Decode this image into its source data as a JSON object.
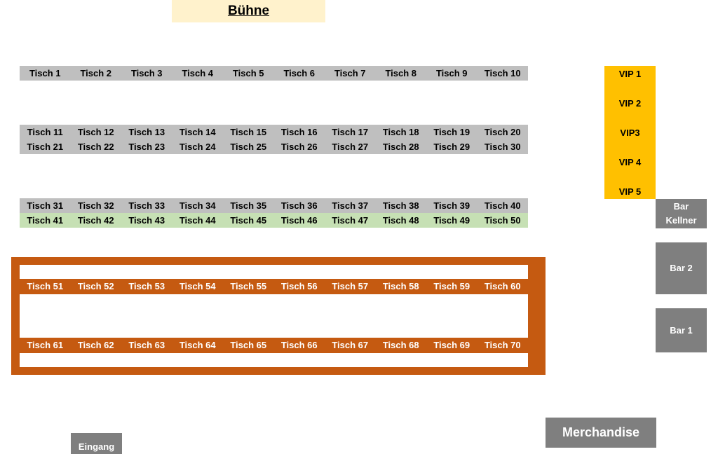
{
  "stage": {
    "label": "Bühne"
  },
  "rows": [
    {
      "style": "gray",
      "tables": [
        "Tisch 1",
        "Tisch 2",
        "Tisch 3",
        "Tisch 4",
        "Tisch 5",
        "Tisch 6",
        "Tisch 7",
        "Tisch 8",
        "Tisch 9",
        "Tisch 10"
      ]
    },
    {
      "style": "gray",
      "tables": [
        "Tisch 11",
        "Tisch 12",
        "Tisch 13",
        "Tisch 14",
        "Tisch 15",
        "Tisch 16",
        "Tisch 17",
        "Tisch 18",
        "Tisch 19",
        "Tisch 20"
      ]
    },
    {
      "style": "gray",
      "tables": [
        "Tisch 21",
        "Tisch 22",
        "Tisch 23",
        "Tisch 24",
        "Tisch 25",
        "Tisch 26",
        "Tisch 27",
        "Tisch 28",
        "Tisch 29",
        "Tisch 30"
      ]
    },
    {
      "style": "gray",
      "tables": [
        "Tisch 31",
        "Tisch 32",
        "Tisch 33",
        "Tisch 34",
        "Tisch 35",
        "Tisch 36",
        "Tisch 37",
        "Tisch 38",
        "Tisch 39",
        "Tisch 40"
      ]
    },
    {
      "style": "green",
      "tables": [
        "Tisch 41",
        "Tisch 42",
        "Tisch 43",
        "Tisch 44",
        "Tisch 45",
        "Tisch 46",
        "Tisch 47",
        "Tisch 48",
        "Tisch 49",
        "Tisch 50"
      ]
    },
    {
      "style": "orange",
      "tables": [
        "Tisch 51",
        "Tisch 52",
        "Tisch 53",
        "Tisch 54",
        "Tisch 55",
        "Tisch 56",
        "Tisch 57",
        "Tisch 58",
        "Tisch 59",
        "Tisch 60"
      ]
    },
    {
      "style": "orange",
      "tables": [
        "Tisch 61",
        "Tisch 62",
        "Tisch 63",
        "Tisch 64",
        "Tisch 65",
        "Tisch 66",
        "Tisch 67",
        "Tisch 68",
        "Tisch 69",
        "Tisch 70"
      ]
    }
  ],
  "vip": [
    "VIP 1",
    "VIP 2",
    "VIP3",
    "VIP 4",
    "VIP 5"
  ],
  "bars": {
    "waiter": "Bar\nKellner",
    "bar2": "Bar 2",
    "bar1": "Bar  1"
  },
  "merchandise": "Merchandise",
  "entrance": "Eingang",
  "colors": {
    "stage": "#fff2cc",
    "gray": "#bfbfbf",
    "green": "#c6e0b4",
    "orange": "#c55a11",
    "vip": "#ffc000",
    "bar": "#7f7f7f"
  }
}
